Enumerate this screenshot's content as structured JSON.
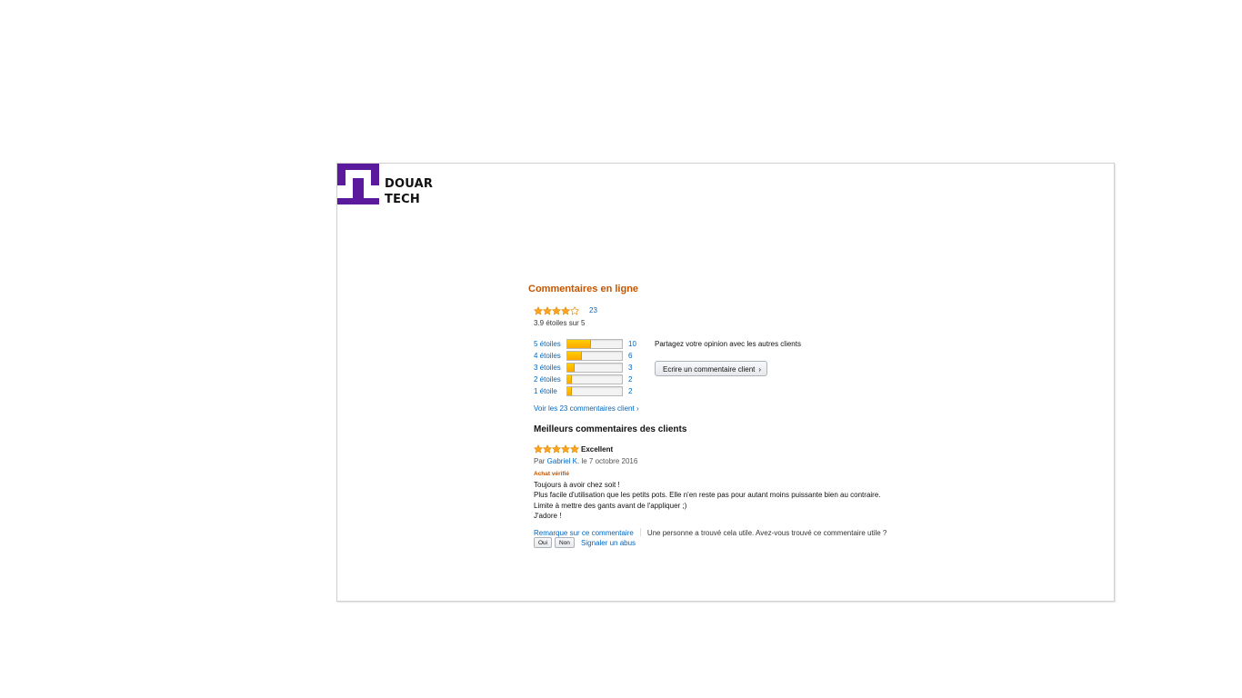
{
  "brand": {
    "line1": "DOUAR",
    "line2": "TECH",
    "color": "#5b1a9e"
  },
  "reviews": {
    "section_title": "Commentaires en ligne",
    "rating_value": 3.9,
    "rating_count": "23",
    "average_text": "3.9 étoiles sur 5",
    "histogram": [
      {
        "label": "5 étoiles",
        "count": "10",
        "percent": 43
      },
      {
        "label": "4 étoiles",
        "count": "6",
        "percent": 26
      },
      {
        "label": "3 étoiles",
        "count": "3",
        "percent": 13
      },
      {
        "label": "2 étoiles",
        "count": "2",
        "percent": 9
      },
      {
        "label": "1 étoile",
        "count": "2",
        "percent": 9
      }
    ],
    "share_text": "Partagez votre opinion avec les autres clients",
    "write_button": "Ecrire un commentaire client",
    "see_all": "Voir les 23 commentaires client ›",
    "best_title": "Meilleurs commentaires des clients",
    "top_review": {
      "stars": 5,
      "title": "Excellent",
      "by_prefix": "Par ",
      "author": "Gabriel K.",
      "date": " le 7 octobre 2016",
      "verified": "Achat vérifié",
      "body": [
        "Toujours à avoir chez soit !",
        "Plus facile d'utilisation que les petits pots. Elle n'en reste pas pour autant moins puissante bien au contraire.",
        "Limite à mettre des gants avant de l'appliquer ;)",
        "J'adore !"
      ],
      "comment_link": "Remarque sur ce commentaire",
      "helpful_text": "Une personne a trouvé cela utile. Avez-vous trouvé ce commentaire utile ?",
      "yes": "Oui",
      "no": "Non",
      "report": "Signaler un abus"
    },
    "colors": {
      "title": "#c45500",
      "link": "#0066c0",
      "star": "#ffa41c"
    }
  }
}
